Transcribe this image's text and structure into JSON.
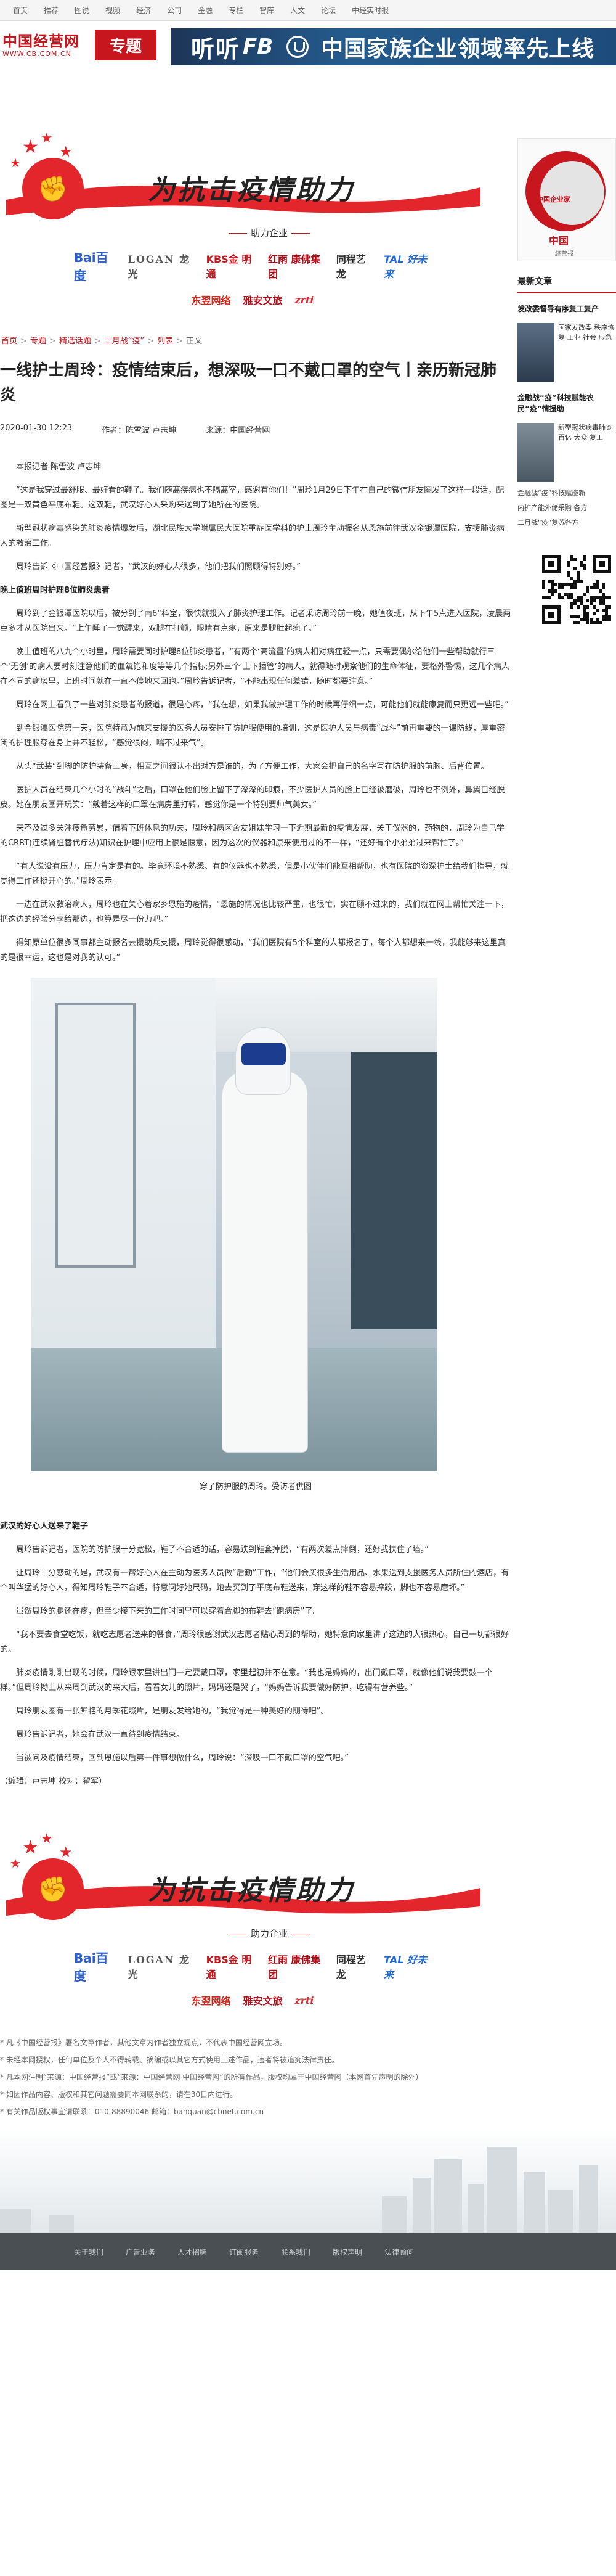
{
  "topnav": [
    "首页",
    "推荐",
    "图说",
    "视频",
    "经济",
    "公司",
    "金融",
    "专栏",
    "智库",
    "人文",
    "论坛",
    "中经实时报"
  ],
  "header": {
    "logo": "中国经营网",
    "logo_url": "WWW.CB.COM.CN",
    "zt_label": "专题",
    "banner_listen": "听听",
    "banner_fb": "FB",
    "banner_slogan": "中国家族企业领域率先上线"
  },
  "banner_block": {
    "slogan": "为抗击疫情助力",
    "help_label": "助力企业",
    "sponsors_row1": [
      "Bai百度",
      "LOGAN 龙光",
      "KBS金 明通",
      "红雨 康佛集团",
      "同程艺龙",
      "TAL 好未来"
    ],
    "sponsors_row2": [
      "东翌网络",
      "雅安文旅",
      "zrti"
    ]
  },
  "breadcrumb": [
    "首页",
    "专题",
    "精选话题",
    "二月战“疫”",
    "列表",
    "正文"
  ],
  "article": {
    "title": "一线护士周玲：疫情结束后，想深吸一口不戴口罩的空气丨亲历新冠肺炎",
    "date": "2020-01-30 12:23",
    "author_label": "作者：",
    "author": "陈雪波 卢志坤",
    "source_label": "来源：",
    "source": "中国经营网",
    "paragraphs": [
      {
        "type": "p",
        "text": "本报记者 陈雪波 卢志坤"
      },
      {
        "type": "p",
        "text": "“这是我穿过最舒服、最好看的鞋子。我们随离疾病也不隔离室，感谢有你们！”周玲1月29日下午在自己的微信朋友圈发了这样一段话，配图是一双黄色平底布鞋。这双鞋，武汉好心人采购来送到了她所在的医院。"
      },
      {
        "type": "p",
        "text": "新型冠状病毒感染的肺炎疫情爆发后，湖北民族大学附属民大医院重症医学科的护士周玲主动报名从恩施前往武汉金银潭医院，支援肺炎病人的救治工作。"
      },
      {
        "type": "p",
        "text": "周玲告诉《中国经营报》记者，“武汉的好心人很多，他们把我们照顾得特别好。”"
      },
      {
        "type": "sub",
        "text": "晚上值班周时护理8位肺炎患者"
      },
      {
        "type": "p",
        "text": "周玲到了金银潭医院以后，被分到了南6“科室，很快就投入了肺炎护理工作。记者采访周玲前一晚，她值夜班，从下午5点进入医院，凌晨两点多才从医院出来。“上午睡了一觉醒来，双腿在打颤，眼睛有点疼，原来是腿肚起疱了。”"
      },
      {
        "type": "p",
        "text": "晚上值班的八九个小时里，周玲需要同时护理8位肺炎患者，“有两个‘高流量’的病人相对病症轻一点，只需要偶尔给他们一些帮助就行三个‘无创’的病人要时刻注意他们的血氧饱和度等等几个指标;另外三个‘上下插管’的病人，就得随时观察他们的生命体征，要格外警惕，这几个病人在不同的病房里，上班时间就在一直不停地来回跑。”周玲告诉记者，“不能出现任何差错，随时都要注意。”"
      },
      {
        "type": "p",
        "text": "周玲在网上看到了一些对肺炎患者的报道，很是心疼，“我在想，如果我做护理工作的时候再仔细一点，可能他们就能康复而只更远一些吧。”"
      },
      {
        "type": "p",
        "text": "到金银潭医院第一天，医院特意为前来支援的医务人员安排了防护服使用的培训，这是医护人员与病毒“战斗”前再重要的一课防线，厚重密闭的护理服穿在身上并不轻松，“感觉很闷，喘不过来气”。"
      },
      {
        "type": "p",
        "text": "从头“武装”到脚的防护装备上身，相互之间很认不出对方是谁的，为了方便工作，大家会把自己的名字写在防护服的前胸、后背位置。"
      },
      {
        "type": "p",
        "text": "医护人员在结束几个小时的“战斗”之后，口罩在他们脸上留下了深深的印痕，不少医护人员的脸上已经被磨破，周玲也不例外，鼻翼已经脱皮。她在朋友圈开玩笑：“戴着这样的口罩在病房里打转，感觉你是一个特别要帅气美女。”"
      },
      {
        "type": "p",
        "text": "来不及过多关注疲惫劳累，借着下班休息的功夫，周玲和病区舍友姐妹学习一下近期最新的疫情发展，关于仪器的，药物的，周玲为自己学的CRRT(连续肾脏替代疗法)知识在护理中应用上很是惬意，因为这次的仪器和原来使用过的不一样，“还好有个小弟弟过来帮忙了。”"
      },
      {
        "type": "p",
        "text": "“有人说没有压力，压力肯定是有的。毕竟环境不熟悉、有的仪器也不熟悉，但是小伙伴们能互相帮助，也有医院的资深护士给我们指导，就觉得工作还挺开心的。”周玲表示。"
      },
      {
        "type": "p",
        "text": "一边在武汉救治病人，周玲也在关心着家乡恩施的疫情，“恩施的情况也比较严重，也很忙，实在顾不过来的，我们就在网上帮忙关注一下，把这边的经验分享给那边，也算是尽一份力吧。”"
      },
      {
        "type": "p",
        "text": "得知原单位很多同事都主动报名去援助兵支援，周玲觉得很感动，“我们医院有5个科室的人都报名了，每个人都想来一线，我能够来这里真的是很幸运，这也是对我的认可。”"
      },
      {
        "type": "photo_caption",
        "text": "穿了防护服的周玲。受访者供图"
      },
      {
        "type": "sub",
        "text": "武汉的好心人送来了鞋子"
      },
      {
        "type": "p",
        "text": "周玲告诉记者，医院的防护服十分宽松，鞋子不合适的话，容易跌到鞋套掉脱，“有两次差点摔倒，还好我扶住了墙。”"
      },
      {
        "type": "p",
        "text": "让周玲十分感动的是，武汉有一帮好心人在主动为医务人员做“后勤”工作，“他们会买很多生活用品、水果送到支援医务人员所住的酒店，有个叫华猛的好心人，得知周玲鞋子不合适，特意问好她尺码，跑去买到了平底布鞋送来，穿这样的鞋不容易摔跤，脚也不容易磨坏。”"
      },
      {
        "type": "p",
        "text": "虽然周玲的腿还在疼，但至少接下来的工作时间里可以穿着合脚的布鞋去“跑病房”了。"
      },
      {
        "type": "p",
        "text": "“我不要去食堂吃饭，就吃志愿者送来的餐食，”周玲很感谢武汉志愿者贴心周到的帮助，她特意向家里讲了这边的人很热心，自己一切都很好的。"
      },
      {
        "type": "p",
        "text": "肺炎疫情刚刚出现的时候，周玲跟家里讲出门一定要戴口罩，家里起初并不在意。“我也是妈妈的，出门戴口罩，就像他们说我要鼓一个样。”但周玲拗上从来周到武汉的来大后，看看女儿的照片，妈妈还是哭了，“妈妈告诉我要做好防护，吃得有营养些。”"
      },
      {
        "type": "p",
        "text": "周玲朋友圈有一张鲜艳的月季花照片，是朋友发给她的，“我觉得是一种美好的期待吧”。"
      },
      {
        "type": "p",
        "text": "周玲告诉记者，她会在武汉一直待到疫情结束。"
      },
      {
        "type": "p",
        "text": "当被问及疫情结束，回到恩施以后第一件事想做什么，周玲说：“深吸一口不戴口罩的空气吧。”"
      },
      {
        "type": "p_noindent",
        "text": "（编辑：卢志坤 校对：翟军）"
      }
    ]
  },
  "disclaimer": [
    "* 凡《中国经营报》署名文章作者，其他文章为作者独立观点，不代表中国经营网立场。",
    "* 未经本网授权，任何单位及个人不得转载、摘编或以其它方式使用上述作品，违者将被追究法律责任。",
    "* 凡本网注明“来源：中国经营报”或“来源：中国经营网 中国经营网”的所有作品，版权均属于中国经营网（本网首先声明的除外）",
    "* 如因作品内容、版权和其它问题需要同本网联系的，请在30日内进行。",
    "* 有关作品版权事宜请联系：010-88890046 邮箱：banquan@cbnet.com.cn"
  ],
  "bottombar": [
    "关于我们",
    "广告业务",
    "人才招聘",
    "订阅服务",
    "联系我们",
    "版权声明",
    "法律顾问"
  ],
  "sidebar": {
    "ad_title": "中国企业家",
    "ad_sub": "中国",
    "ad_small": "经营报",
    "latest_title": "最新文章",
    "item1_text": "发改委督导有序复工复产",
    "item1_detail": "国家发改委 秩序恢复 工业 社会 应急",
    "item2_text": "金融战“疫”科技赋能农民“疫”情援助",
    "item2_detail": "新型冠状病毒肺炎 百亿 大众 复工",
    "links": [
      "金融战“疫”科技赋能新",
      "内扩产能外储采购 各方",
      "二月战“疫”复苏各方"
    ]
  }
}
